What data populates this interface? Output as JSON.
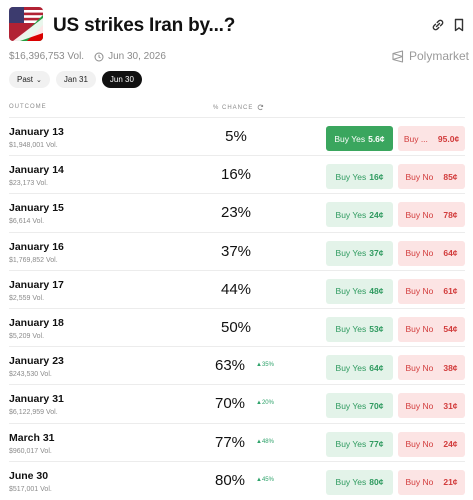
{
  "market": {
    "title": "US strikes Iran by...?",
    "volume": "$16,396,753 Vol.",
    "date": "Jun 30, 2026",
    "brand": "Polymarket"
  },
  "filters": [
    {
      "label": "Past",
      "active": false,
      "dropdown": true
    },
    {
      "label": "Jan 31",
      "active": false
    },
    {
      "label": "Jun 30",
      "active": true
    }
  ],
  "columns": {
    "outcome": "OUTCOME",
    "chance": "% CHANCE"
  },
  "outcomes": [
    {
      "date": "January 13",
      "vol": "$1,948,001 Vol.",
      "pct": "5%",
      "delta": "",
      "yes_label": "Buy Yes",
      "yes_price": "5.6¢",
      "no_label": "Buy ...",
      "no_price": "95.0¢",
      "selected": true
    },
    {
      "date": "January 14",
      "vol": "$23,173 Vol.",
      "pct": "16%",
      "delta": "",
      "yes_label": "Buy Yes",
      "yes_price": "16¢",
      "no_label": "Buy No",
      "no_price": "85¢"
    },
    {
      "date": "January 15",
      "vol": "$6,614 Vol.",
      "pct": "23%",
      "delta": "",
      "yes_label": "Buy Yes",
      "yes_price": "24¢",
      "no_label": "Buy No",
      "no_price": "78¢"
    },
    {
      "date": "January 16",
      "vol": "$1,769,852 Vol.",
      "pct": "37%",
      "delta": "",
      "yes_label": "Buy Yes",
      "yes_price": "37¢",
      "no_label": "Buy No",
      "no_price": "64¢"
    },
    {
      "date": "January 17",
      "vol": "$2,559 Vol.",
      "pct": "44%",
      "delta": "",
      "yes_label": "Buy Yes",
      "yes_price": "48¢",
      "no_label": "Buy No",
      "no_price": "61¢"
    },
    {
      "date": "January 18",
      "vol": "$5,209 Vol.",
      "pct": "50%",
      "delta": "",
      "yes_label": "Buy Yes",
      "yes_price": "53¢",
      "no_label": "Buy No",
      "no_price": "54¢"
    },
    {
      "date": "January 23",
      "vol": "$243,530 Vol.",
      "pct": "63%",
      "delta": "▲35%",
      "yes_label": "Buy Yes",
      "yes_price": "64¢",
      "no_label": "Buy No",
      "no_price": "38¢"
    },
    {
      "date": "January 31",
      "vol": "$6,122,959 Vol.",
      "pct": "70%",
      "delta": "▲20%",
      "yes_label": "Buy Yes",
      "yes_price": "70¢",
      "no_label": "Buy No",
      "no_price": "31¢"
    },
    {
      "date": "March 31",
      "vol": "$960,017 Vol.",
      "pct": "77%",
      "delta": "▲48%",
      "yes_label": "Buy Yes",
      "yes_price": "77¢",
      "no_label": "Buy No",
      "no_price": "24¢"
    },
    {
      "date": "June 30",
      "vol": "$517,001 Vol.",
      "pct": "80%",
      "delta": "▲45%",
      "yes_label": "Buy Yes",
      "yes_price": "80¢",
      "no_label": "Buy No",
      "no_price": "21¢"
    }
  ],
  "icons": {
    "link": "link-icon",
    "bookmark": "bookmark-icon",
    "clock": "clock-icon",
    "refresh": "refresh-icon",
    "flag": "us-iran-flag-icon"
  },
  "colors": {
    "yes": "#3aa65e",
    "no": "#d23c3c",
    "delta": "#2fa36b"
  }
}
